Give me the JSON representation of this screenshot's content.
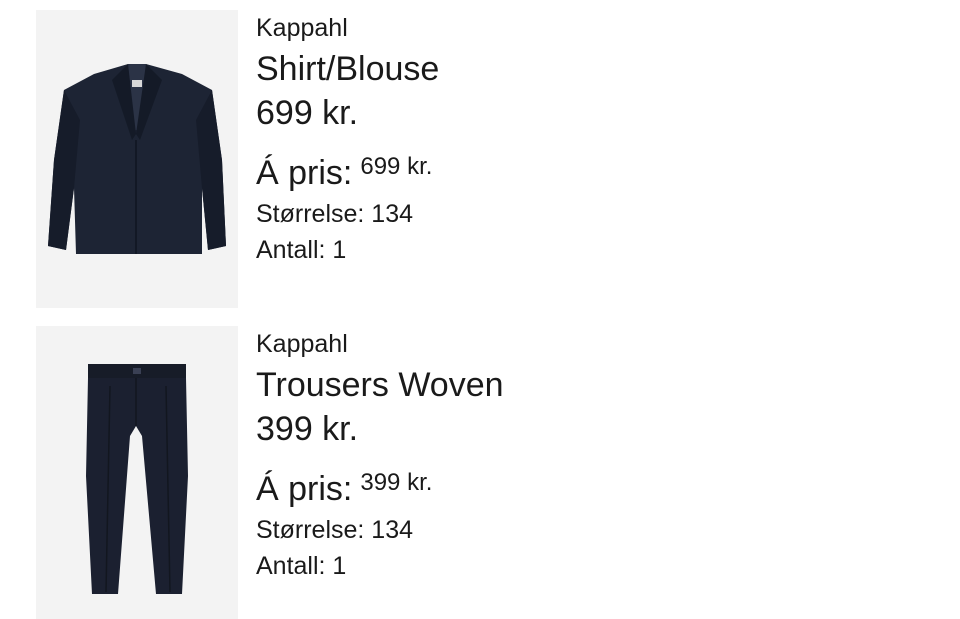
{
  "items": [
    {
      "brand": "Kappahl",
      "name": "Shirt/Blouse",
      "price": "699 kr.",
      "unit_price_label": "Á pris:",
      "unit_price_value": "699 kr.",
      "size": "Størrelse: 134",
      "quantity": "Antall: 1",
      "image_icon": "jacket-icon"
    },
    {
      "brand": "Kappahl",
      "name": "Trousers Woven",
      "price": "399 kr.",
      "unit_price_label": "Á pris:",
      "unit_price_value": "399 kr.",
      "size": "Størrelse: 134",
      "quantity": "Antall: 1",
      "image_icon": "trousers-icon"
    }
  ],
  "colors": {
    "garment": "#1c2333",
    "image_bg": "#f3f3f3",
    "text": "#1a1a1a"
  }
}
